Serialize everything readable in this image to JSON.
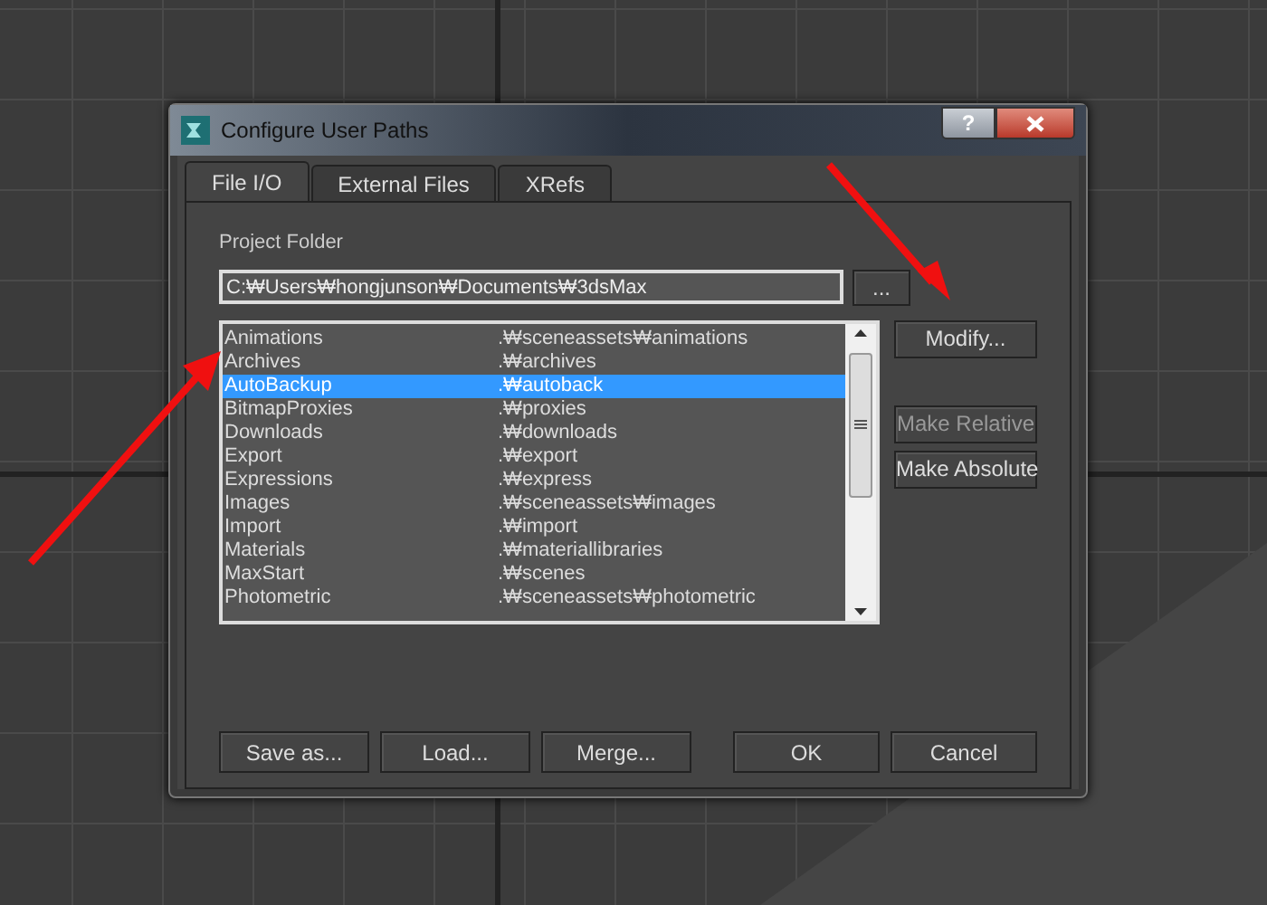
{
  "window": {
    "title": "Configure User Paths",
    "help_button": "?"
  },
  "tabs": [
    {
      "label": "File I/O",
      "selected": true
    },
    {
      "label": "External Files",
      "selected": false
    },
    {
      "label": "XRefs",
      "selected": false
    }
  ],
  "project_folder": {
    "label": "Project Folder",
    "value": "C:₩Users₩hongjunson₩Documents₩3dsMax",
    "browse_button": "..."
  },
  "paths": [
    {
      "name": "Animations",
      "path": ".₩sceneassets₩animations",
      "selected": false
    },
    {
      "name": "Archives",
      "path": ".₩archives",
      "selected": false
    },
    {
      "name": "AutoBackup",
      "path": ".₩autoback",
      "selected": true
    },
    {
      "name": "BitmapProxies",
      "path": ".₩proxies",
      "selected": false
    },
    {
      "name": "Downloads",
      "path": ".₩downloads",
      "selected": false
    },
    {
      "name": "Export",
      "path": ".₩export",
      "selected": false
    },
    {
      "name": "Expressions",
      "path": ".₩express",
      "selected": false
    },
    {
      "name": "Images",
      "path": ".₩sceneassets₩images",
      "selected": false
    },
    {
      "name": "Import",
      "path": ".₩import",
      "selected": false
    },
    {
      "name": "Materials",
      "path": ".₩materiallibraries",
      "selected": false
    },
    {
      "name": "MaxStart",
      "path": ".₩scenes",
      "selected": false
    },
    {
      "name": "Photometric",
      "path": ".₩sceneassets₩photometric",
      "selected": false
    }
  ],
  "side_buttons": [
    {
      "label": "Modify...",
      "disabled": false
    },
    {
      "label": "Make Relative",
      "disabled": true
    },
    {
      "label": "Make Absolute",
      "disabled": false
    }
  ],
  "bottom_buttons": [
    "Save as...",
    "Load...",
    "Merge..."
  ],
  "dialog_buttons": [
    "OK",
    "Cancel"
  ]
}
